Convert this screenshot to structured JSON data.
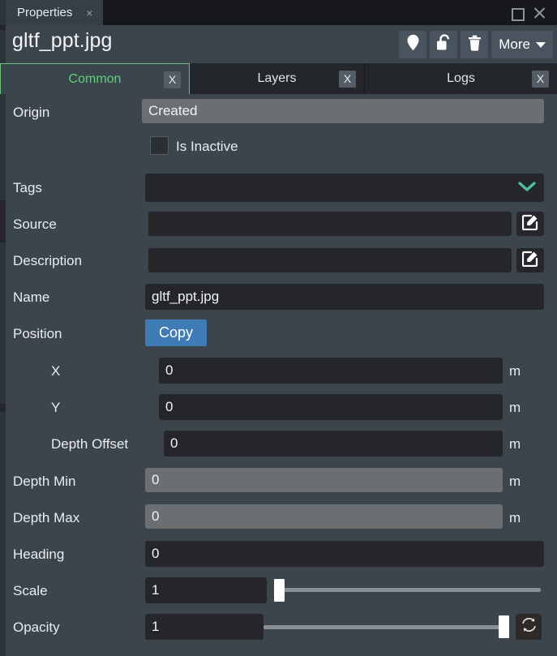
{
  "window": {
    "tab_title": "Properties",
    "tab_close_glyph": "×",
    "maximize_label": "Maximize",
    "close_label": "Close"
  },
  "header": {
    "filename": "gltf_ppt.jpg",
    "toolbar": [
      {
        "name": "pin-icon",
        "label": ""
      },
      {
        "name": "unlock-icon",
        "label": ""
      },
      {
        "name": "trash-icon",
        "label": ""
      }
    ],
    "more_label": "More"
  },
  "tabs": [
    {
      "label": "Common",
      "active": true,
      "close_glyph": "X"
    },
    {
      "label": "Layers",
      "active": false,
      "close_glyph": "X"
    },
    {
      "label": "Logs",
      "active": false,
      "close_glyph": "X"
    }
  ],
  "form": {
    "origin": {
      "label": "Origin",
      "value": "Created"
    },
    "is_inactive": {
      "label": "Is Inactive",
      "checked": false
    },
    "tags": {
      "label": "Tags",
      "value": "",
      "placeholder": ""
    },
    "source": {
      "label": "Source",
      "value": "",
      "placeholder": ""
    },
    "description": {
      "label": "Description",
      "value": "",
      "placeholder": ""
    },
    "name": {
      "label": "Name",
      "value": "gltf_ppt.jpg",
      "placeholder": ""
    },
    "position": {
      "label": "Position",
      "copy_label": "Copy"
    },
    "x": {
      "label": "X",
      "value": "0",
      "unit": "m"
    },
    "y": {
      "label": "Y",
      "value": "0",
      "unit": "m"
    },
    "depth_offset": {
      "label": "Depth Offset",
      "value": "0",
      "unit": "m"
    },
    "depth_min": {
      "label": "Depth Min",
      "value": "0",
      "unit": "m"
    },
    "depth_max": {
      "label": "Depth Max",
      "value": "0",
      "unit": "m"
    },
    "heading": {
      "label": "Heading",
      "value": "0"
    },
    "scale": {
      "label": "Scale",
      "value": "1",
      "slider_percent": 2
    },
    "opacity": {
      "label": "Opacity",
      "value": "1",
      "slider_percent": 100
    }
  },
  "colors": {
    "panel": "#3c444c",
    "titlebar": "#16181b",
    "field_dark": "#24262a",
    "field_gray": "#6b6f72",
    "accent_green": "#5fd17f",
    "accent_teal": "#4fbf9b",
    "accent_blue": "#3f7cb5"
  }
}
